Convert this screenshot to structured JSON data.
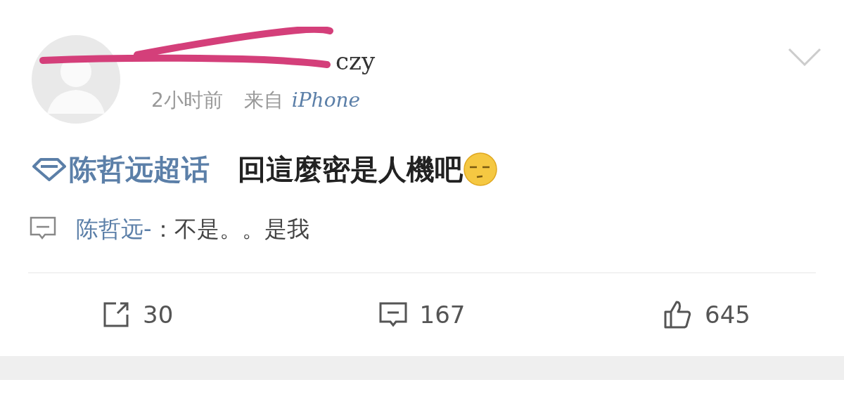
{
  "post": {
    "author": "czy",
    "author_scribbled": true,
    "time": "2小时前",
    "source_prefix": "来自",
    "source": "iPhone",
    "topic": "陈哲远超话",
    "text": "回這麼密是人機吧",
    "comment": {
      "user": "陈哲远-",
      "separator": "：",
      "text": "不是。。是我"
    }
  },
  "actions": [
    {
      "kind": "repost",
      "count": "30"
    },
    {
      "kind": "comment",
      "count": "167"
    },
    {
      "kind": "like",
      "count": "645"
    }
  ]
}
